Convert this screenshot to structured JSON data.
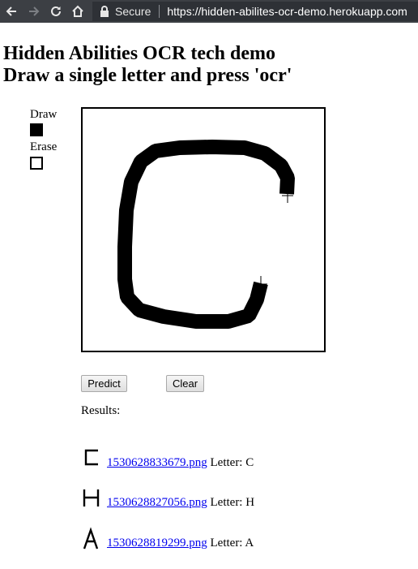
{
  "browser": {
    "secure_label": "Secure",
    "url": "https://hidden-abilites-ocr-demo.herokuapp.com",
    "icons": [
      "back-arrow-icon",
      "forward-arrow-icon",
      "reload-icon",
      "home-icon",
      "lock-icon"
    ]
  },
  "page": {
    "title_line1": "Hidden Abilities OCR tech demo",
    "title_line2": "Draw a single letter and press 'ocr'"
  },
  "tools": {
    "draw_label": "Draw",
    "erase_label": "Erase"
  },
  "buttons": {
    "predict": "Predict",
    "clear": "Clear"
  },
  "results": {
    "label": "Results:",
    "items": [
      {
        "glyph": "C",
        "file": "1530628833679.png",
        "letter_text": "Letter: C"
      },
      {
        "glyph": "H",
        "file": "1530628827056.png",
        "letter_text": "Letter: H"
      },
      {
        "glyph": "A",
        "file": "1530628819299.png",
        "letter_text": "Letter: A"
      }
    ]
  },
  "colors": {
    "toolbar_bg": "#3c3f44",
    "link": "#0000ee",
    "stroke": "#000000"
  }
}
